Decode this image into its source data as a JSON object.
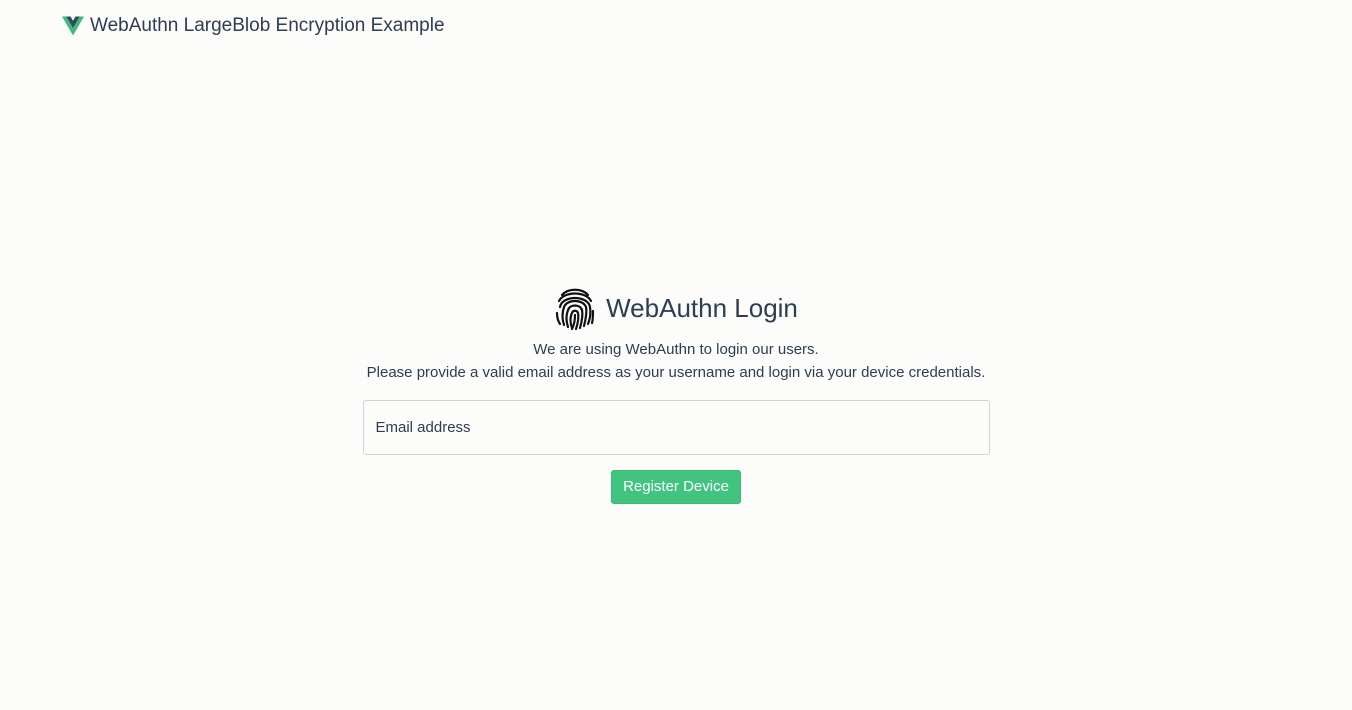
{
  "navbar": {
    "logo_icon": "vue-logo-icon",
    "brand": "WebAuthn LargeBlob Encryption Example"
  },
  "login": {
    "icon": "fingerprint-icon",
    "title": "WebAuthn Login",
    "description_line1": "We are using WebAuthn to login our users.",
    "description_line2": "Please provide a valid email address as your username and login via your device credentials.",
    "email_placeholder": "Email address",
    "email_value": "",
    "register_button": "Register Device"
  },
  "colors": {
    "accent": "#41c47f",
    "text": "#2c3e50",
    "background": "#fcfcfb",
    "logo_green": "#41b883",
    "logo_dark": "#35495e"
  }
}
